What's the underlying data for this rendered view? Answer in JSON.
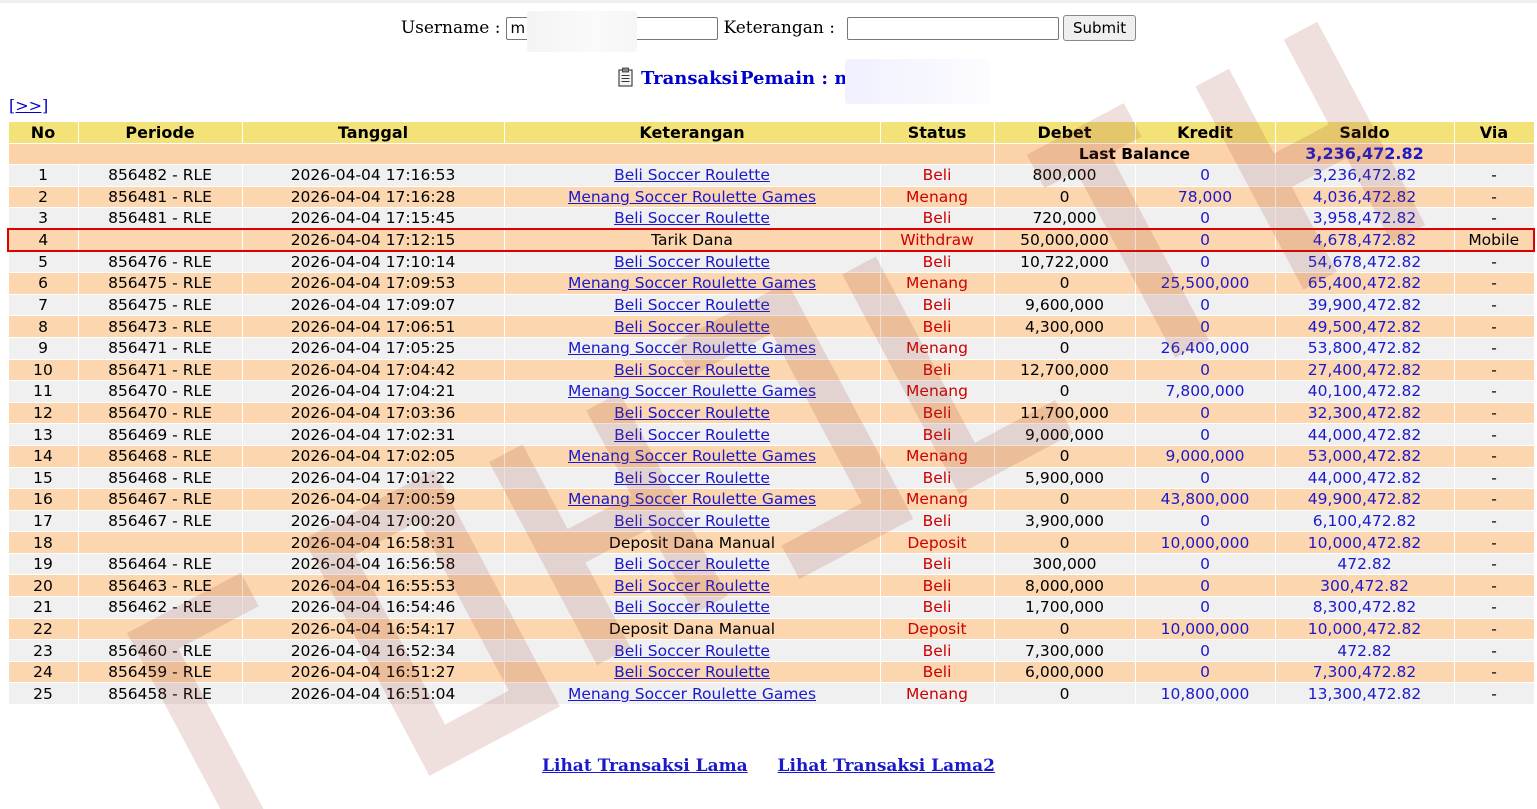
{
  "form": {
    "username_label": "Username :",
    "username_value": "m",
    "keterangan_label": "Keterangan :",
    "keterangan_value": "",
    "submit_label": "Submit"
  },
  "title": {
    "transaksi": "Transaksi",
    "pemain": "Pemain : mi"
  },
  "nav": {
    "next_label": "[>>]"
  },
  "table": {
    "headers": [
      "No",
      "Periode",
      "Tanggal",
      "Keterangan",
      "Status",
      "Debet",
      "Kredit",
      "Saldo",
      "Via"
    ],
    "last_balance_label": "Last Balance",
    "last_balance_value": "3,236,472.82",
    "rows": [
      {
        "no": "1",
        "periode": "856482 - RLE",
        "tanggal": "2026-04-04 17:16:53",
        "ket": "Beli Soccer Roulette",
        "link": true,
        "status": "Beli",
        "debet": "800,000",
        "kredit": "0",
        "saldo": "3,236,472.82",
        "via": "-"
      },
      {
        "no": "2",
        "periode": "856481 - RLE",
        "tanggal": "2026-04-04 17:16:28",
        "ket": "Menang Soccer Roulette Games",
        "link": true,
        "status": "Menang",
        "debet": "0",
        "kredit": "78,000",
        "saldo": "4,036,472.82",
        "via": "-"
      },
      {
        "no": "3",
        "periode": "856481 - RLE",
        "tanggal": "2026-04-04 17:15:45",
        "ket": "Beli Soccer Roulette",
        "link": true,
        "status": "Beli",
        "debet": "720,000",
        "kredit": "0",
        "saldo": "3,958,472.82",
        "via": "-"
      },
      {
        "no": "4",
        "periode": "",
        "tanggal": "2026-04-04 17:12:15",
        "ket": "Tarik Dana",
        "link": false,
        "status": "Withdraw",
        "debet": "50,000,000",
        "kredit": "0",
        "saldo": "4,678,472.82",
        "via": "Mobile"
      },
      {
        "no": "5",
        "periode": "856476 - RLE",
        "tanggal": "2026-04-04 17:10:14",
        "ket": "Beli Soccer Roulette",
        "link": true,
        "status": "Beli",
        "debet": "10,722,000",
        "kredit": "0",
        "saldo": "54,678,472.82",
        "via": "-"
      },
      {
        "no": "6",
        "periode": "856475 - RLE",
        "tanggal": "2026-04-04 17:09:53",
        "ket": "Menang Soccer Roulette Games",
        "link": true,
        "status": "Menang",
        "debet": "0",
        "kredit": "25,500,000",
        "saldo": "65,400,472.82",
        "via": "-"
      },
      {
        "no": "7",
        "periode": "856475 - RLE",
        "tanggal": "2026-04-04 17:09:07",
        "ket": "Beli Soccer Roulette",
        "link": true,
        "status": "Beli",
        "debet": "9,600,000",
        "kredit": "0",
        "saldo": "39,900,472.82",
        "via": "-"
      },
      {
        "no": "8",
        "periode": "856473 - RLE",
        "tanggal": "2026-04-04 17:06:51",
        "ket": "Beli Soccer Roulette",
        "link": true,
        "status": "Beli",
        "debet": "4,300,000",
        "kredit": "0",
        "saldo": "49,500,472.82",
        "via": "-"
      },
      {
        "no": "9",
        "periode": "856471 - RLE",
        "tanggal": "2026-04-04 17:05:25",
        "ket": "Menang Soccer Roulette Games",
        "link": true,
        "status": "Menang",
        "debet": "0",
        "kredit": "26,400,000",
        "saldo": "53,800,472.82",
        "via": "-"
      },
      {
        "no": "10",
        "periode": "856471 - RLE",
        "tanggal": "2026-04-04 17:04:42",
        "ket": "Beli Soccer Roulette",
        "link": true,
        "status": "Beli",
        "debet": "12,700,000",
        "kredit": "0",
        "saldo": "27,400,472.82",
        "via": "-"
      },
      {
        "no": "11",
        "periode": "856470 - RLE",
        "tanggal": "2026-04-04 17:04:21",
        "ket": "Menang Soccer Roulette Games",
        "link": true,
        "status": "Menang",
        "debet": "0",
        "kredit": "7,800,000",
        "saldo": "40,100,472.82",
        "via": "-"
      },
      {
        "no": "12",
        "periode": "856470 - RLE",
        "tanggal": "2026-04-04 17:03:36",
        "ket": "Beli Soccer Roulette",
        "link": true,
        "status": "Beli",
        "debet": "11,700,000",
        "kredit": "0",
        "saldo": "32,300,472.82",
        "via": "-"
      },
      {
        "no": "13",
        "periode": "856469 - RLE",
        "tanggal": "2026-04-04 17:02:31",
        "ket": "Beli Soccer Roulette",
        "link": true,
        "status": "Beli",
        "debet": "9,000,000",
        "kredit": "0",
        "saldo": "44,000,472.82",
        "via": "-"
      },
      {
        "no": "14",
        "periode": "856468 - RLE",
        "tanggal": "2026-04-04 17:02:05",
        "ket": "Menang Soccer Roulette Games",
        "link": true,
        "status": "Menang",
        "debet": "0",
        "kredit": "9,000,000",
        "saldo": "53,000,472.82",
        "via": "-"
      },
      {
        "no": "15",
        "periode": "856468 - RLE",
        "tanggal": "2026-04-04 17:01:22",
        "ket": "Beli Soccer Roulette",
        "link": true,
        "status": "Beli",
        "debet": "5,900,000",
        "kredit": "0",
        "saldo": "44,000,472.82",
        "via": "-"
      },
      {
        "no": "16",
        "periode": "856467 - RLE",
        "tanggal": "2026-04-04 17:00:59",
        "ket": "Menang Soccer Roulette Games",
        "link": true,
        "status": "Menang",
        "debet": "0",
        "kredit": "43,800,000",
        "saldo": "49,900,472.82",
        "via": "-"
      },
      {
        "no": "17",
        "periode": "856467 - RLE",
        "tanggal": "2026-04-04 17:00:20",
        "ket": "Beli Soccer Roulette",
        "link": true,
        "status": "Beli",
        "debet": "3,900,000",
        "kredit": "0",
        "saldo": "6,100,472.82",
        "via": "-"
      },
      {
        "no": "18",
        "periode": "",
        "tanggal": "2026-04-04 16:58:31",
        "ket": "Deposit Dana Manual",
        "link": false,
        "status": "Deposit",
        "debet": "0",
        "kredit": "10,000,000",
        "saldo": "10,000,472.82",
        "via": "-"
      },
      {
        "no": "19",
        "periode": "856464 - RLE",
        "tanggal": "2026-04-04 16:56:58",
        "ket": "Beli Soccer Roulette",
        "link": true,
        "status": "Beli",
        "debet": "300,000",
        "kredit": "0",
        "saldo": "472.82",
        "via": "-"
      },
      {
        "no": "20",
        "periode": "856463 - RLE",
        "tanggal": "2026-04-04 16:55:53",
        "ket": "Beli Soccer Roulette",
        "link": true,
        "status": "Beli",
        "debet": "8,000,000",
        "kredit": "0",
        "saldo": "300,472.82",
        "via": "-"
      },
      {
        "no": "21",
        "periode": "856462 - RLE",
        "tanggal": "2026-04-04 16:54:46",
        "ket": "Beli Soccer Roulette",
        "link": true,
        "status": "Beli",
        "debet": "1,700,000",
        "kredit": "0",
        "saldo": "8,300,472.82",
        "via": "-"
      },
      {
        "no": "22",
        "periode": "",
        "tanggal": "2026-04-04 16:54:17",
        "ket": "Deposit Dana Manual",
        "link": false,
        "status": "Deposit",
        "debet": "0",
        "kredit": "10,000,000",
        "saldo": "10,000,472.82",
        "via": "-"
      },
      {
        "no": "23",
        "periode": "856460 - RLE",
        "tanggal": "2026-04-04 16:52:34",
        "ket": "Beli Soccer Roulette",
        "link": true,
        "status": "Beli",
        "debet": "7,300,000",
        "kredit": "0",
        "saldo": "472.82",
        "via": "-"
      },
      {
        "no": "24",
        "periode": "856459 - RLE",
        "tanggal": "2026-04-04 16:51:27",
        "ket": "Beli Soccer Roulette",
        "link": true,
        "status": "Beli",
        "debet": "6,000,000",
        "kredit": "0",
        "saldo": "7,300,472.82",
        "via": "-"
      },
      {
        "no": "25",
        "periode": "856458 - RLE",
        "tanggal": "2026-04-04 16:51:04",
        "ket": "Menang Soccer Roulette Games",
        "link": true,
        "status": "Menang",
        "debet": "0",
        "kredit": "10,800,000",
        "saldo": "13,300,472.82",
        "via": "-"
      }
    ]
  },
  "footer": {
    "link1": "Lihat Transaksi Lama",
    "link2": "Lihat Transaksi Lama2"
  },
  "colors": {
    "header_bg": "#f2e277",
    "row_peach": "#fcd6ae",
    "row_gray": "#f0f0f0",
    "status_red": "#cc0000",
    "link_blue": "#1a1acc",
    "highlight_border": "#dd0000"
  }
}
